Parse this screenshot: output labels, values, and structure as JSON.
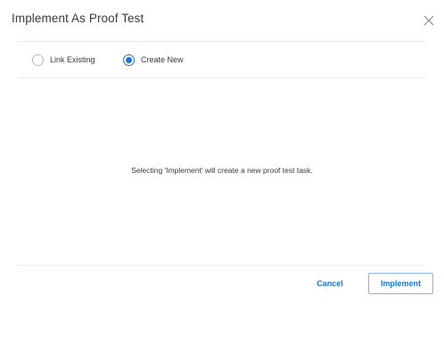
{
  "dialog": {
    "title": "Implement As Proof Test",
    "close_icon": "close-icon"
  },
  "options": {
    "link_existing_label": "Link Existing",
    "create_new_label": "Create New",
    "selected": "Create New"
  },
  "message": "Selecting 'Implement' will create a new proof test task.",
  "footer": {
    "cancel_label": "Cancel",
    "implement_label": "Implement"
  },
  "colors": {
    "accent": "#1a73d9",
    "text": "#3a3a3a",
    "divider": "#ececec"
  }
}
